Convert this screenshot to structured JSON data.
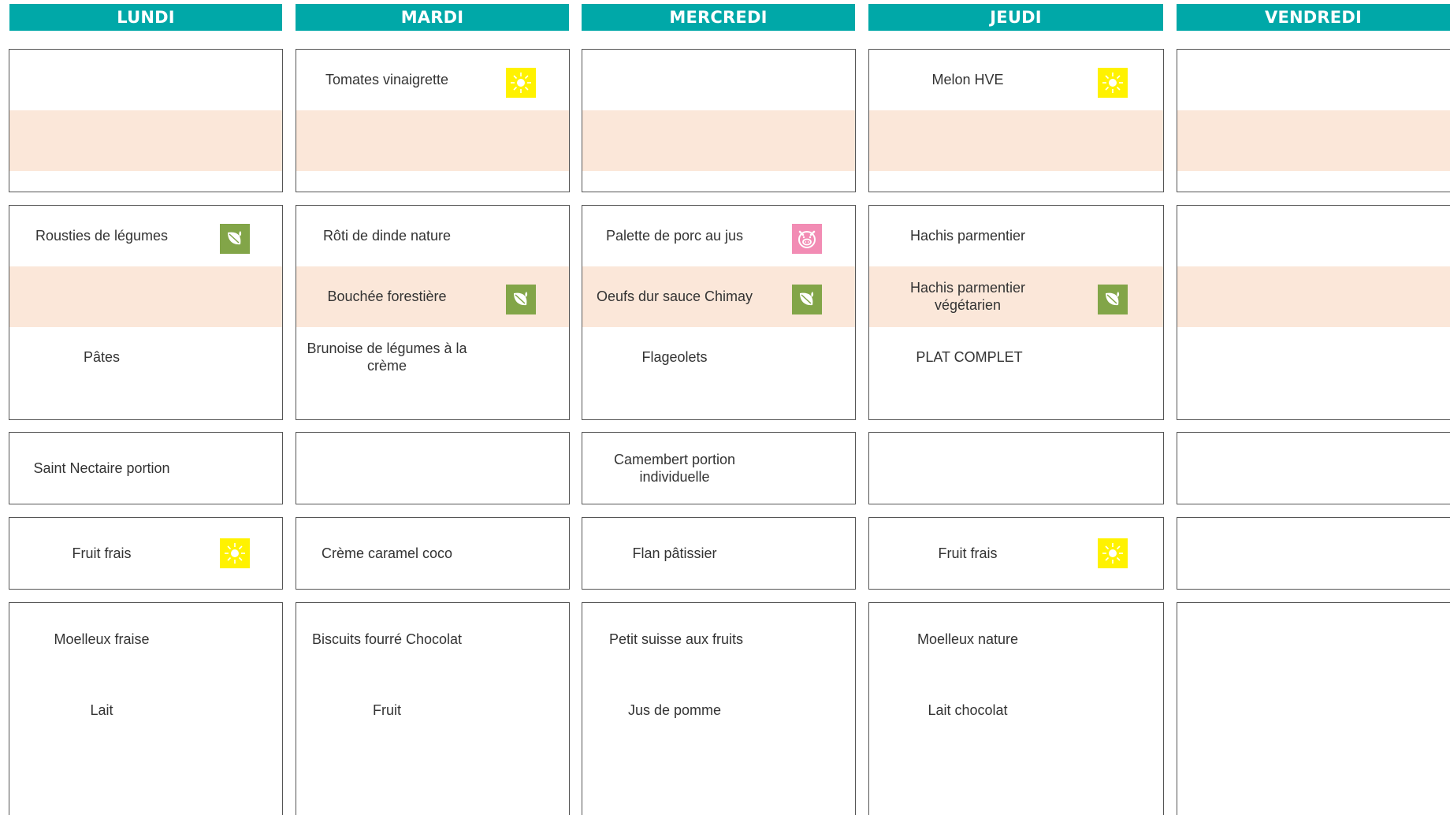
{
  "days": [
    "LUNDI",
    "MARDI",
    "MERCREDI",
    "JEUDI",
    "VENDREDI"
  ],
  "colors": {
    "header": "#00a8a8",
    "band": "#fbe7d9",
    "sun": "#fff200",
    "leaf": "#82a548",
    "pig": "#f28cb4"
  },
  "icons": {
    "sun": "seasonal-sun-icon",
    "leaf": "vegetarian-leaf-icon",
    "pig": "pork-pig-icon"
  },
  "entrees": {
    "mardi": "Tomates vinaigrette",
    "jeudi": "Melon HVE"
  },
  "plats": {
    "lundi": {
      "main": "Rousties de légumes",
      "side": "Pâtes"
    },
    "mardi": {
      "main": "Rôti de dinde nature",
      "alt": "Bouchée forestière",
      "side": "Brunoise de légumes à la crème"
    },
    "mercredi": {
      "main": "Palette de porc au jus",
      "alt": "Oeufs dur sauce Chimay",
      "side": "Flageolets"
    },
    "jeudi": {
      "main": "Hachis parmentier",
      "alt": "Hachis parmentier végétarien",
      "side": "PLAT COMPLET"
    }
  },
  "fromages": {
    "lundi": "Saint Nectaire portion",
    "mercredi": "Camembert portion individuelle"
  },
  "desserts": {
    "lundi": "Fruit frais",
    "mardi": "Crème caramel coco",
    "mercredi": "Flan pâtissier",
    "jeudi": "Fruit frais"
  },
  "gouters": {
    "lundi": {
      "a": "Moelleux fraise",
      "b": "Lait"
    },
    "mardi": {
      "a": "Biscuits fourré Chocolat",
      "b": "Fruit"
    },
    "mercredi": {
      "a": "Petit suisse aux fruits",
      "b": "Jus de pomme"
    },
    "jeudi": {
      "a": "Moelleux nature",
      "b": "Lait chocolat"
    }
  }
}
